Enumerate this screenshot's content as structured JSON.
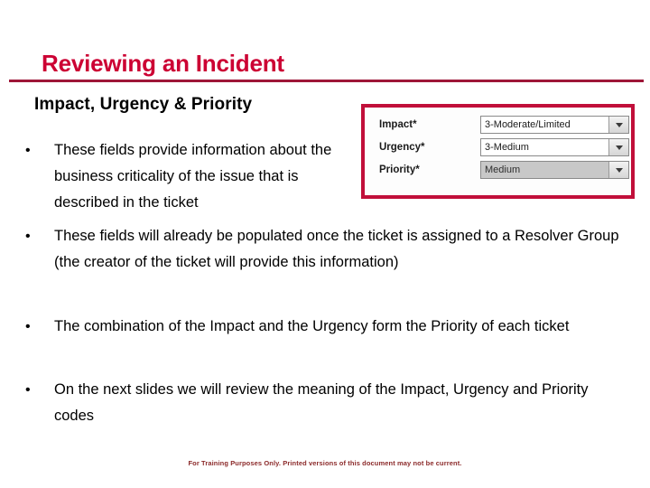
{
  "slide": {
    "title": "Reviewing an Incident",
    "subtitle": "Impact, Urgency & Priority",
    "bullet_marker": "•",
    "bullets": [
      "These fields provide information about the business criticality of the issue that is described in the ticket",
      "These fields will already be populated once the ticket is assigned to a Resolver Group (the creator of the ticket will provide this information)",
      "The combination of the Impact and the Urgency form the Priority of each ticket",
      "On the next slides we will review the meaning of the Impact, Urgency and Priority codes"
    ],
    "footer": "For Training Purposes Only. Printed versions of this document may not be current."
  },
  "form_screenshot": {
    "fields": [
      {
        "label": "Impact*",
        "value": "3-Moderate/Limited",
        "state": "enabled",
        "arrow_icon": "chevron-down-icon"
      },
      {
        "label": "Urgency*",
        "value": "3-Medium",
        "state": "enabled",
        "arrow_icon": "chevron-down-icon"
      },
      {
        "label": "Priority*",
        "value": "Medium",
        "state": "disabled",
        "arrow_icon": "chevron-down-icon"
      }
    ]
  },
  "colors": {
    "title_red": "#cc0033",
    "rule_maroon": "#9e1638",
    "form_border_red": "#c10f3a",
    "footer_red": "#8c2b2b",
    "body_text": "#000000"
  }
}
